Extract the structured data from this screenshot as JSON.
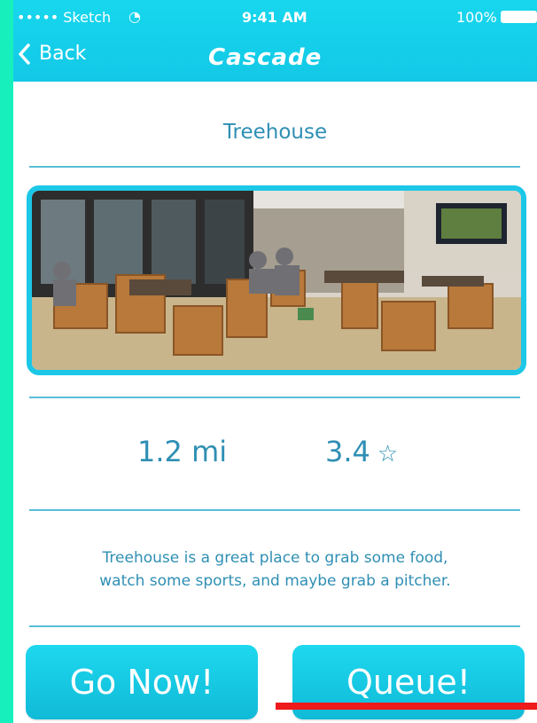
{
  "status_bar": {
    "carrier": "••••• Sketch",
    "time": "9:41 AM",
    "battery": "100%"
  },
  "nav": {
    "back_label": "Back",
    "title": "Cascade"
  },
  "place": {
    "name": "Treehouse",
    "distance": "1.2 mi",
    "rating": "3.4",
    "description_line1": "Treehouse is a great place to grab some food,",
    "description_line2": "watch some sports, and maybe grab a pitcher."
  },
  "actions": {
    "go_now": "Go Now!",
    "queue": "Queue!"
  },
  "colors": {
    "accent": "#17d7ee",
    "text": "#2f8fb4",
    "side": "#17f0bd",
    "highlight": "#ef1a1a"
  },
  "icons": {
    "back": "chevron-left-icon",
    "rating": "star-outline-icon",
    "wifi": "wifi-icon",
    "battery": "battery-icon"
  }
}
